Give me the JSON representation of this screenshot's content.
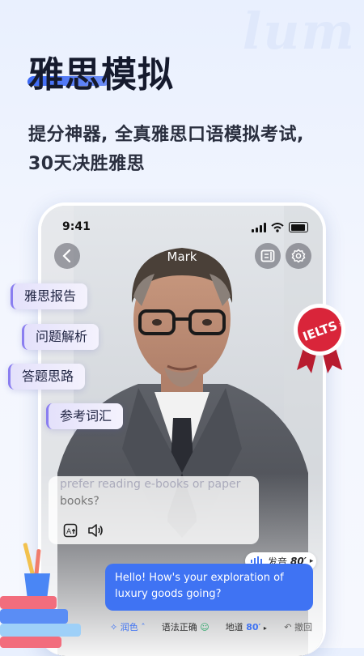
{
  "banner": {
    "deco": "lum",
    "headline": "雅思模拟",
    "subline1": "提分神器, 全真雅思口语模拟考试,",
    "subline2": "30天决胜雅思"
  },
  "phone": {
    "status_time": "9:41",
    "interlocutor_name": "Mark",
    "badge_text": "IELTS",
    "badge_trademark": "TM",
    "menu_pills": [
      "雅思报告",
      "问题解析",
      "答题思路",
      "参考词汇"
    ],
    "caption_line1": "prefer reading e-books or paper",
    "caption_line2": "books?",
    "pronunciation_label": "发音",
    "pronunciation_score": "80′",
    "chat_message": "Hello! How's your exploration of luxury goods going?",
    "bottom_bar": {
      "polish": "润色",
      "grammar": "语法正确",
      "fluency_label": "地道",
      "fluency_score": "80′",
      "undo": "撤回"
    }
  },
  "colors": {
    "accent": "#3f73f3",
    "headline": "#151a2d",
    "badge_red": "#d9253a"
  }
}
